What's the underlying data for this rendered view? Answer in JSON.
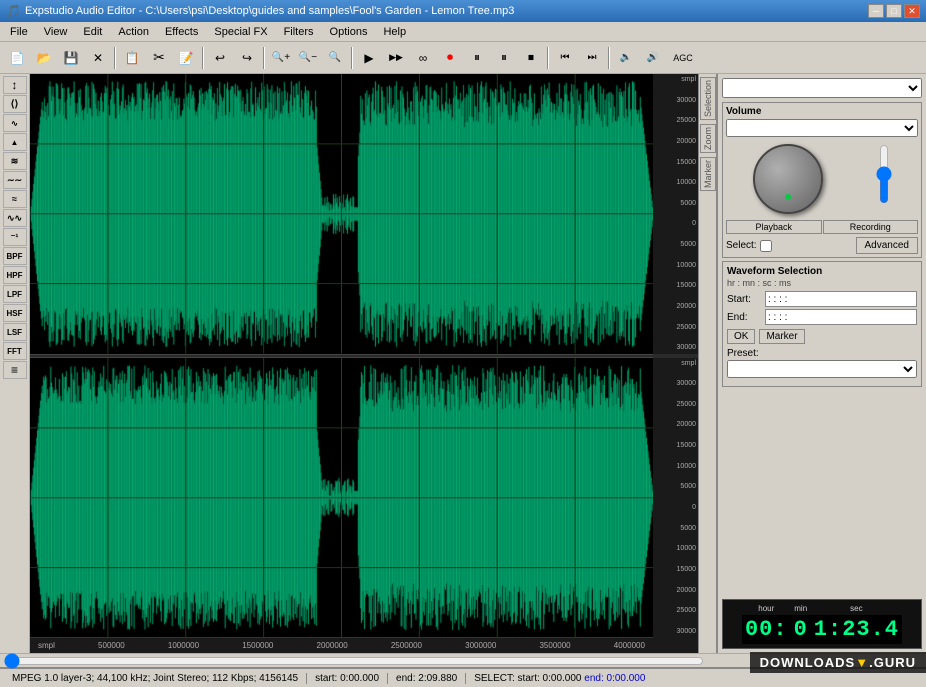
{
  "titlebar": {
    "title": "Expstudio Audio Editor - C:\\Users\\psi\\Desktop\\guides and samples\\Fool's Garden - Lemon Tree.mp3",
    "min_label": "─",
    "max_label": "□",
    "close_label": "✕"
  },
  "menubar": {
    "items": [
      "File",
      "View",
      "Edit",
      "Action",
      "Effects",
      "Special FX",
      "Filters",
      "Options",
      "Help"
    ]
  },
  "toolbar": {
    "buttons": [
      "📂",
      "💾",
      "✕",
      "📋",
      "✂",
      "📄",
      "↩",
      "↪",
      "🔍+",
      "🔍-",
      "🔍",
      "▶",
      "⏵⏵",
      "∞",
      "⏺",
      "⏸",
      "⏸",
      "⏹",
      "⏮",
      "⏭",
      "AGC"
    ]
  },
  "left_tools": {
    "buttons": [
      "↕",
      "⟨⟩",
      "∿",
      "▲",
      "≋",
      "∼∼",
      "≈",
      "∿∿",
      "⁻¹",
      "BPF",
      "HPF",
      "LPF",
      "HSF",
      "LSF",
      "FFT",
      "≡"
    ]
  },
  "yaxis_top": {
    "labels": [
      "smpl",
      "30000",
      "25000",
      "20000",
      "15000",
      "10000",
      "5000",
      "0",
      "5000",
      "10000",
      "15000",
      "20000",
      "25000",
      "30000"
    ]
  },
  "yaxis_bottom": {
    "labels": [
      "smpl",
      "30000",
      "25000",
      "20000",
      "15000",
      "10000",
      "5000",
      "0",
      "5000",
      "10000",
      "15000",
      "20000",
      "25000",
      "30000"
    ]
  },
  "xaxis": {
    "labels": [
      "smpl",
      "500000",
      "1000000",
      "1500000",
      "2000000",
      "2500000",
      "3000000",
      "3500000",
      "4000000"
    ]
  },
  "right_panel": {
    "dropdown_default": "",
    "volume_label": "Volume",
    "volume_option": "",
    "playback_tab": "Playback",
    "recording_tab": "Recording",
    "select_label": "Select:",
    "advanced_label": "Advanced",
    "waveform_selection": {
      "title": "Waveform Selection",
      "subtitle": "hr : mn : sc : ms",
      "start_label": "Start:",
      "start_value": ": : : :",
      "end_label": "End:",
      "end_value": ": : : :",
      "ok_label": "OK",
      "marker_label": "Marker",
      "preset_label": "Preset:"
    }
  },
  "time_display": {
    "hour_label": "hour",
    "min_label": "min",
    "sec_label": "sec",
    "hour_value": "00:",
    "min_value": "0",
    "sec_value": "1:23.4"
  },
  "statusbar": {
    "info": "MPEG 1.0 layer-3; 44,100 kHz; Joint Stereo; 112 Kbps;  4156145",
    "start": "start: 0:00.000",
    "end": "end: 2:09.880",
    "select": "SELECT: start: 0:00.000",
    "select_end": "end: 0:00.000"
  },
  "sidebar_vertical": {
    "labels": [
      "Selection",
      "Zoom",
      "Marker"
    ]
  }
}
